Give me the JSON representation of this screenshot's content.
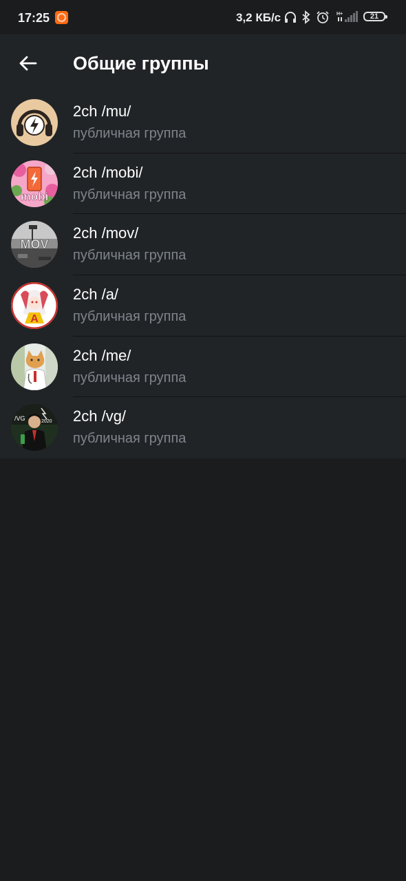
{
  "status_bar": {
    "time": "17:25",
    "speed": "3,2 КБ/с",
    "network": "H+",
    "battery": "21"
  },
  "header": {
    "title": "Общие группы"
  },
  "groups": [
    {
      "name": "2ch /mu/",
      "subtitle": "публичная группа"
    },
    {
      "name": "2ch /mobi/",
      "subtitle": "публичная группа",
      "avatar_text": "mobi"
    },
    {
      "name": "2ch /mov/",
      "subtitle": "публичная группа",
      "avatar_text": "MOV"
    },
    {
      "name": "2ch /a/",
      "subtitle": "публичная группа",
      "avatar_text": "A"
    },
    {
      "name": "2ch /me/",
      "subtitle": "публичная группа"
    },
    {
      "name": "2ch /vg/",
      "subtitle": "публичная группа",
      "avatar_text": "/VG",
      "avatar_text_2": "2020"
    }
  ],
  "colors": {
    "background": "#1b1c1e",
    "surface": "#212427",
    "primary_text": "#ffffff",
    "secondary_text": "#7e858c"
  }
}
